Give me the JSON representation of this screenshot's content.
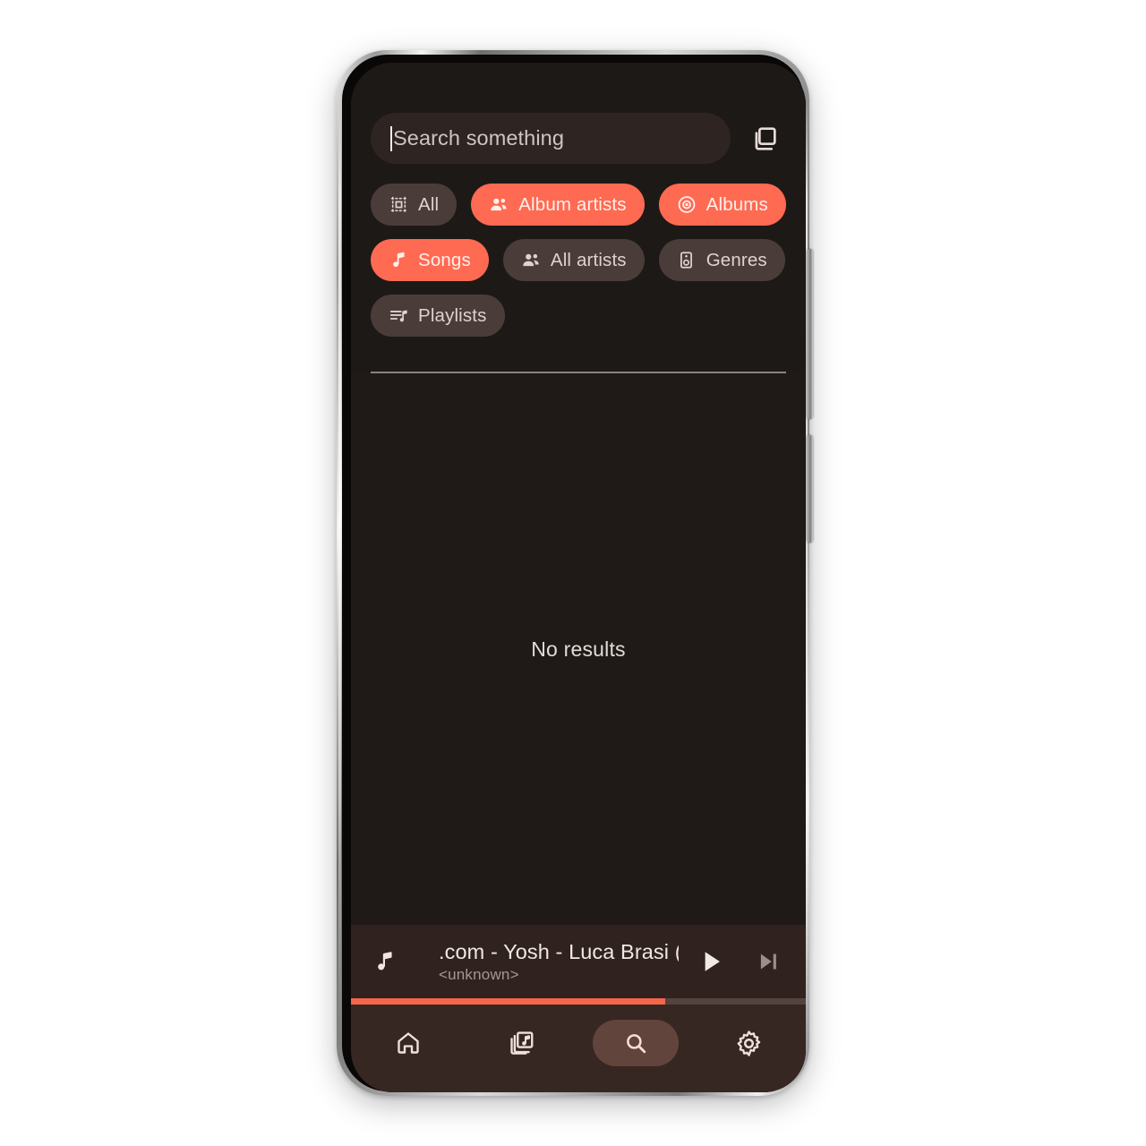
{
  "app": {
    "accent": "#ff6a52",
    "surface": "#1d1917",
    "player_surface": "#30231f",
    "nav_surface": "#372722",
    "chip_surface": "#4a3d39"
  },
  "search": {
    "placeholder": "Search something",
    "value": "",
    "select_all_icon": "select-all-icon"
  },
  "filter_chips": [
    {
      "label": "All",
      "icon": "select-all-square-icon",
      "selected": false
    },
    {
      "label": "Album artists",
      "icon": "people-icon",
      "selected": true
    },
    {
      "label": "Albums",
      "icon": "album-disc-icon",
      "selected": true
    },
    {
      "label": "Songs",
      "icon": "music-note-icon",
      "selected": true
    },
    {
      "label": "All artists",
      "icon": "people-icon",
      "selected": false
    },
    {
      "label": "Genres",
      "icon": "speaker-icon",
      "selected": false
    },
    {
      "label": "Playlists",
      "icon": "queue-music-icon",
      "selected": false
    }
  ],
  "results": {
    "empty_message": "No results"
  },
  "player": {
    "thumb_icon": "music-note-icon",
    "title": ".com - Yosh - Luca Brasi (",
    "subtitle": "<unknown>",
    "play_label": "play-icon",
    "next_label": "skip-next-icon",
    "progress_percent": 69
  },
  "bottom_nav": [
    {
      "name": "home",
      "icon": "home-icon",
      "active": false
    },
    {
      "name": "library",
      "icon": "library-music-icon",
      "active": false
    },
    {
      "name": "search",
      "icon": "search-icon",
      "active": true
    },
    {
      "name": "settings",
      "icon": "gear-icon",
      "active": false
    }
  ]
}
